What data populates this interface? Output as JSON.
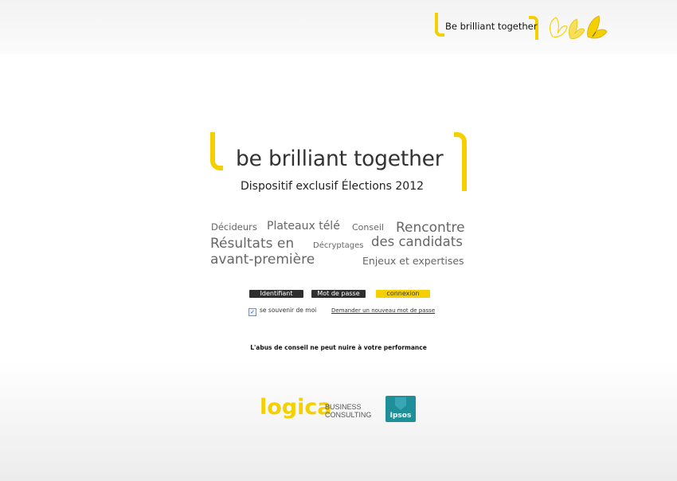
{
  "header": {
    "slogan": "Be brilliant together",
    "butterflies_icon": "butterflies-icon"
  },
  "hero": {
    "slogan": "be brilliant together",
    "subtitle": "Dispositif exclusif Élections 2012"
  },
  "word_cloud": [
    "Décideurs",
    "Plateaux télé",
    "Conseil",
    "Rencontre",
    "des candidats",
    "Résultats en",
    "Décryptages",
    "avant-première",
    "Enjeux et expertises"
  ],
  "login": {
    "username_label": "Identifiant",
    "password_label": "Mot de passe",
    "connect_label": "connexion",
    "remember_label": "se souvenir de moi",
    "remember_checked": true,
    "forgot_label": "Demander un nouveau mot de passe"
  },
  "tagline": "L'abus de conseil ne peut nuire à votre performance",
  "partners": {
    "logica_wordmark": "logica",
    "logica_sub1": "BUSINESS",
    "logica_sub2": "CONSULTING",
    "ipsos": "Ipsos"
  },
  "colors": {
    "brand_yellow": "#f5d000",
    "dark_label": "#2e2e2e",
    "ipsos_teal": "#1f8f9a"
  }
}
